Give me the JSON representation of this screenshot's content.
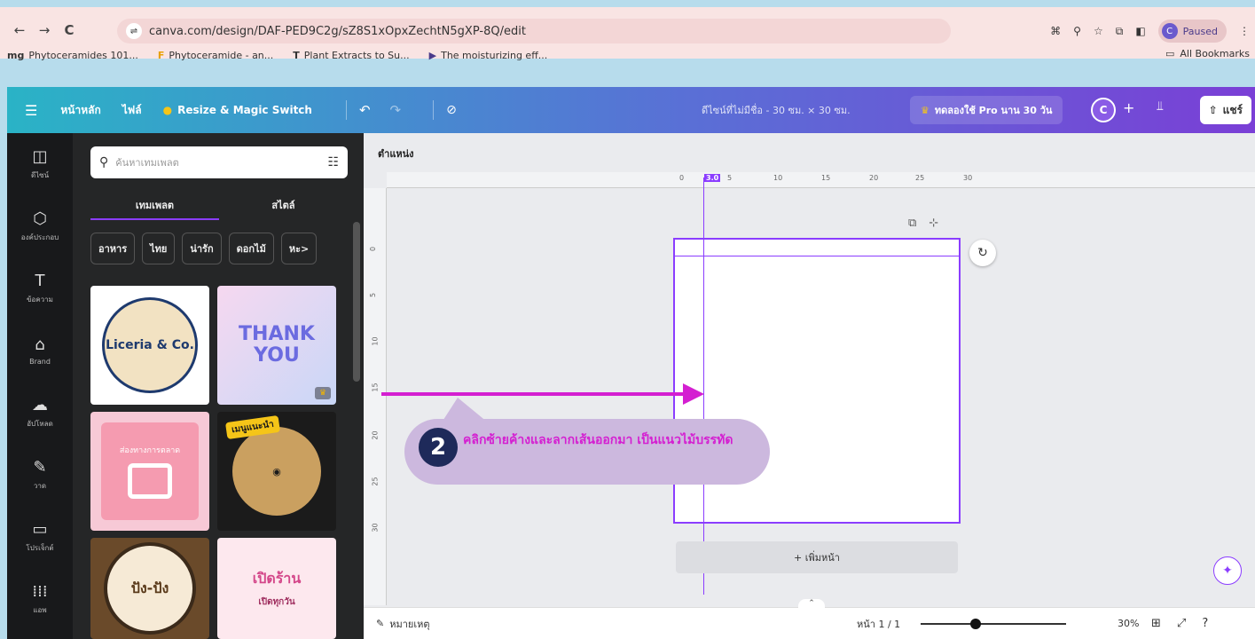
{
  "browser": {
    "url": "canva.com/design/DAF-PED9C2g/sZ8S1xOpxZechtN5gXP-8Q/edit",
    "profile_status": "Paused",
    "profile_initial": "C",
    "bookmarks": [
      {
        "icon": "mg",
        "label": "Phytoceramides 101..."
      },
      {
        "icon": "F",
        "label": "Phytoceramide - an..."
      },
      {
        "icon": "T",
        "label": "Plant Extracts to Su..."
      },
      {
        "icon": "▶",
        "label": "The moisturizing eff..."
      }
    ],
    "all_bookmarks": "All Bookmarks"
  },
  "header": {
    "home": "หน้าหลัก",
    "file": "ไฟล์",
    "resize": "Resize & Magic Switch",
    "design_title": "ดีไซน์ที่ไม่มีชื่อ - 30 ซม. × 30 ซม.",
    "try_pro": "ทดลองใช้ Pro นาน 30 วัน",
    "avatar_initial": "C",
    "share": "แชร์"
  },
  "rail": [
    {
      "icon": "◫",
      "label": "ดีไซน์"
    },
    {
      "icon": "⬡",
      "label": "องค์ประกอบ"
    },
    {
      "icon": "T",
      "label": "ข้อความ"
    },
    {
      "icon": "⌂",
      "label": "Brand"
    },
    {
      "icon": "☁",
      "label": "อัปโหลด"
    },
    {
      "icon": "✎",
      "label": "วาด"
    },
    {
      "icon": "▭",
      "label": "โปรเจ็กต์"
    },
    {
      "icon": "⁞⁞⁞",
      "label": "แอพ"
    }
  ],
  "panel": {
    "search_placeholder": "ค้นหาเทมเพลต",
    "tabs": [
      "เทมเพลต",
      "สไตล์"
    ],
    "chips": [
      "อาหาร",
      "ไทย",
      "น่ารัก",
      "ดอกไม้",
      "หะ>"
    ],
    "tiles": {
      "t1": "Liceria & Co.",
      "t2": "THANK YOU",
      "t3": "ส่องทางการตลาด",
      "t4_badge": "เมนูแนะนำ",
      "t5": "ปัง-ปัง",
      "t6_title": "เปิดร้าน",
      "t6_sub": "เปิดทุกวัน"
    }
  },
  "editor": {
    "position_label": "ตำแหน่ง",
    "ruler_top": [
      "0",
      "3.0",
      "5",
      "10",
      "15",
      "20",
      "25",
      "30"
    ],
    "ruler_side": [
      "0",
      "5",
      "10",
      "15",
      "20",
      "25",
      "30"
    ],
    "add_page": "+ เพิ่มหน้า",
    "notes": "หมายเหตุ",
    "page_indicator": "หน้า 1 / 1",
    "zoom": "30%",
    "zoom_level_fraction": 0.38
  },
  "annotation": {
    "step": "2",
    "text": "คลิกซ้ายค้างและลากเส้นออกมา เป็นแนวไม้บรรทัด",
    "color": "#d41fd1"
  }
}
